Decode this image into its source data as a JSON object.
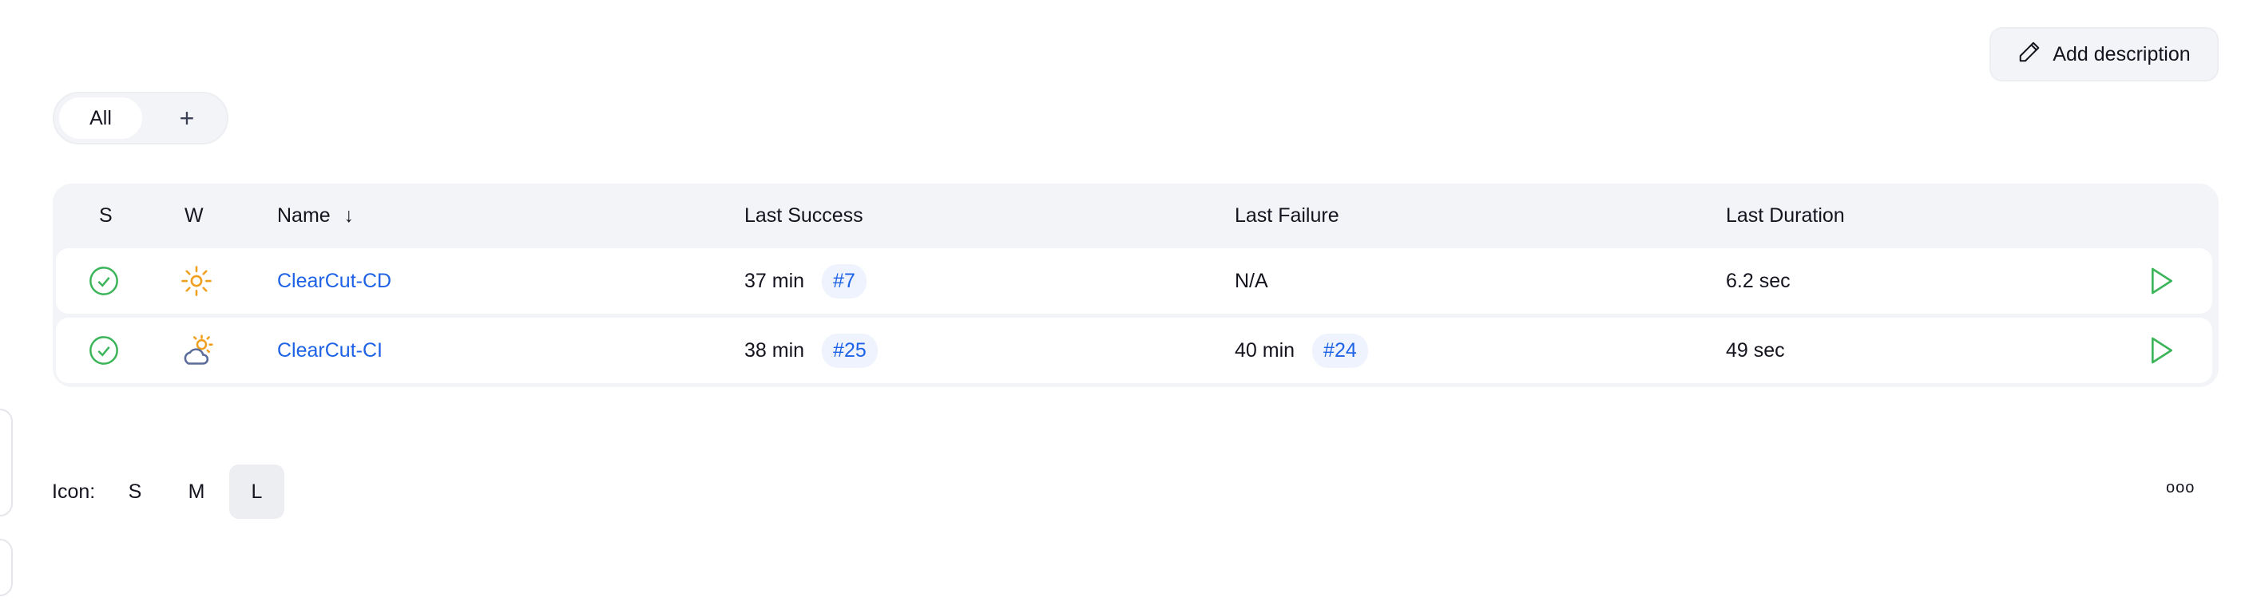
{
  "header": {
    "add_description_label": "Add description"
  },
  "tabs": {
    "all_label": "All",
    "add_label": "+"
  },
  "table": {
    "columns": {
      "status": "S",
      "weather": "W",
      "name": "Name",
      "name_sort": "↓",
      "last_success": "Last Success",
      "last_failure": "Last Failure",
      "last_duration": "Last Duration"
    },
    "rows": [
      {
        "name": "ClearCut-CD",
        "weather": "sunny",
        "last_success": "37 min",
        "last_success_build": "#7",
        "last_failure": "N/A",
        "last_failure_build": null,
        "last_duration": "6.2 sec"
      },
      {
        "name": "ClearCut-CI",
        "weather": "partly-cloudy",
        "last_success": "38 min",
        "last_success_build": "#25",
        "last_failure": "40 min",
        "last_failure_build": "#24",
        "last_duration": "49 sec"
      }
    ]
  },
  "footer": {
    "icon_label": "Icon:",
    "sizes": [
      "S",
      "M",
      "L"
    ],
    "selected_size": "L",
    "more_label": "ooo"
  },
  "colors": {
    "success": "#3cb55a",
    "link": "#1e62e6",
    "sun": "#f0a020",
    "cloud": "#5a6b9a"
  }
}
